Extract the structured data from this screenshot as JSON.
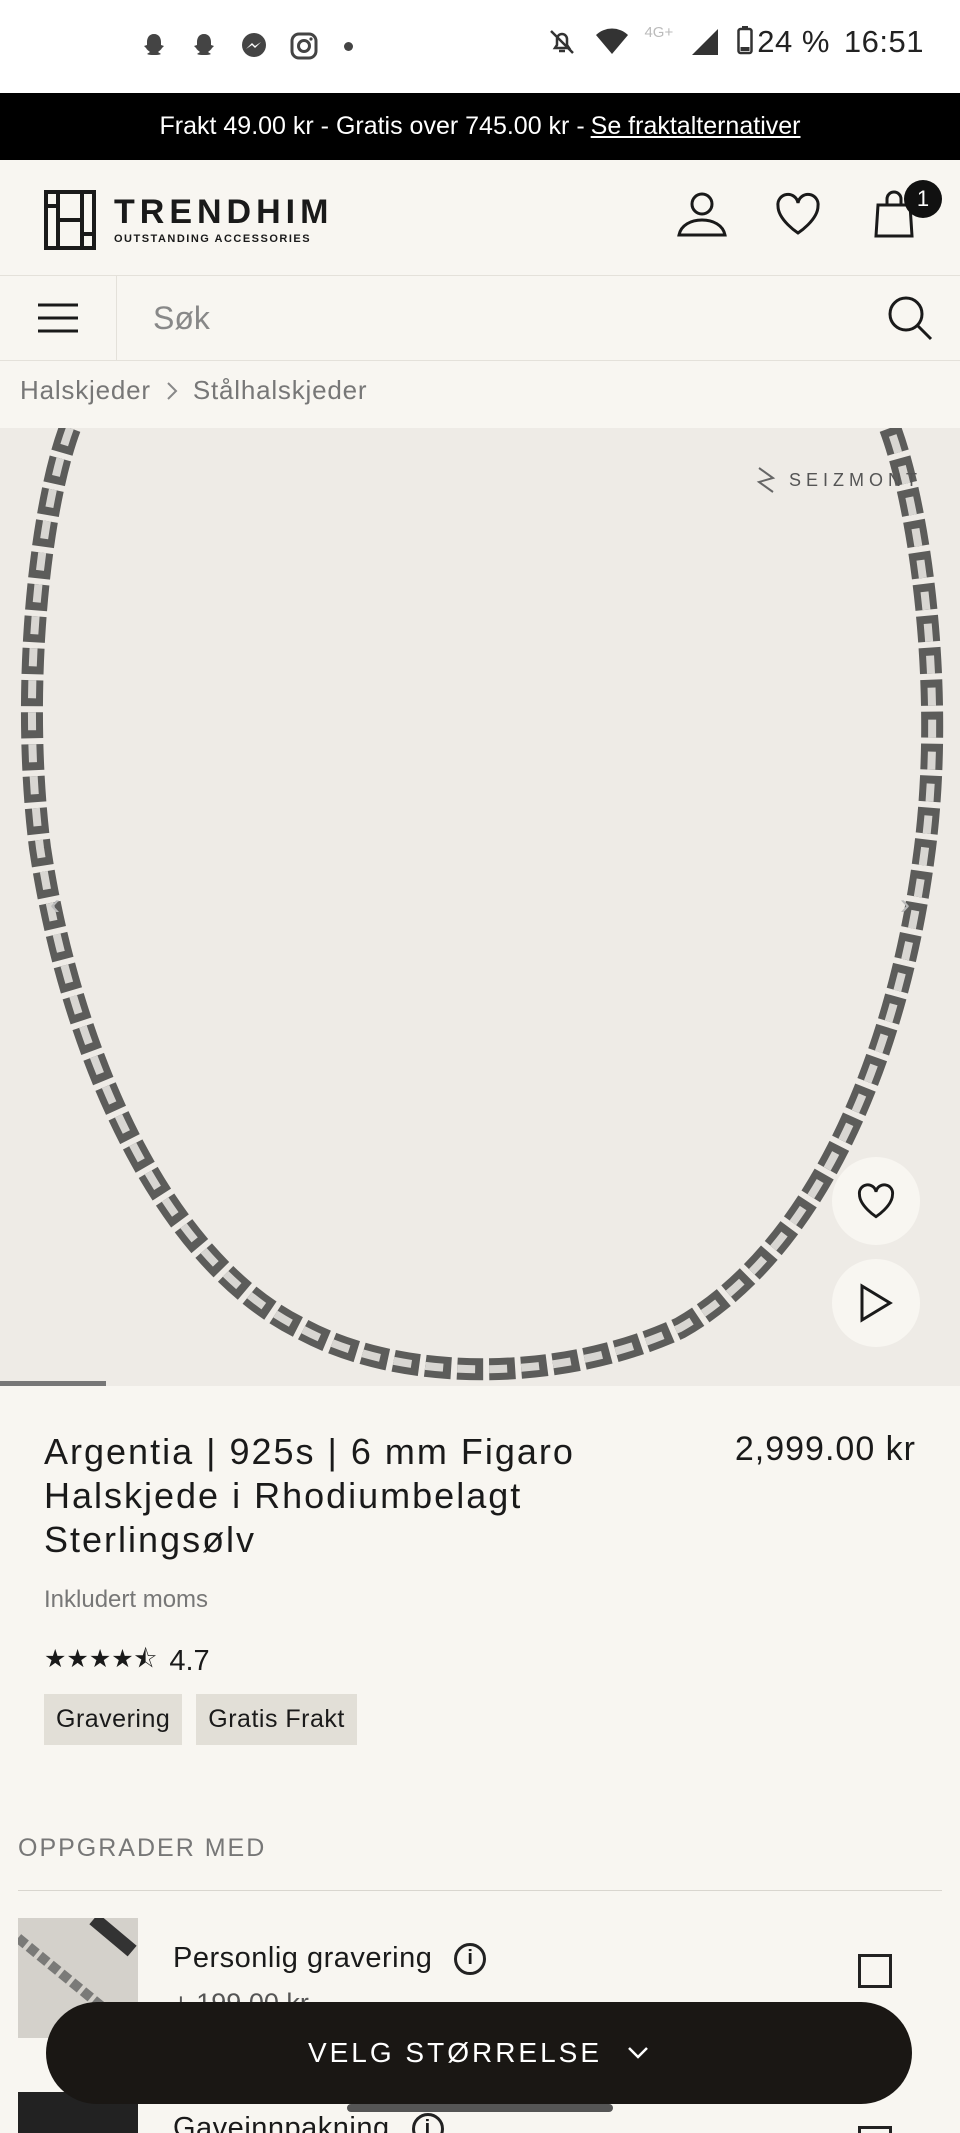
{
  "status_bar": {
    "network": "4G+",
    "battery": "24 %",
    "time": "16:51"
  },
  "promo": {
    "text": "Frakt 49.00 kr - Gratis over 745.00 kr -",
    "link": "Se fraktalternativer"
  },
  "header": {
    "logo_name": "TRENDHIM",
    "logo_tagline": "OUTSTANDING ACCESSORIES",
    "cart_count": "1"
  },
  "search": {
    "placeholder": "Søk"
  },
  "breadcrumb": {
    "items": [
      "Halskjeder",
      "Stålhalskjeder"
    ]
  },
  "gallery": {
    "brand": "SEIZMONT",
    "progress": 0.11
  },
  "product": {
    "title": "Argentia | 925s | 6 mm Figaro Halskjede i Rhodiumbelagt Sterlingsølv",
    "price": "2,999.00 kr",
    "vat_note": "Inkludert moms",
    "rating": "4.7",
    "rating_value": 4.7,
    "tags": [
      "Gravering",
      "Gratis Frakt"
    ]
  },
  "upgrades": {
    "title": "OPPGRADER MED",
    "items": [
      {
        "label": "Personlig gravering",
        "price": "+ 199.00 kr"
      },
      {
        "label": "Gaveinnpakning",
        "price": ""
      }
    ]
  },
  "cta": {
    "label": "VELG STØRRELSE"
  },
  "colors": {
    "background": "#f8f6f1",
    "promo_bar": "#000000",
    "cta": "#1a1714",
    "tag": "#e2dfd7"
  }
}
